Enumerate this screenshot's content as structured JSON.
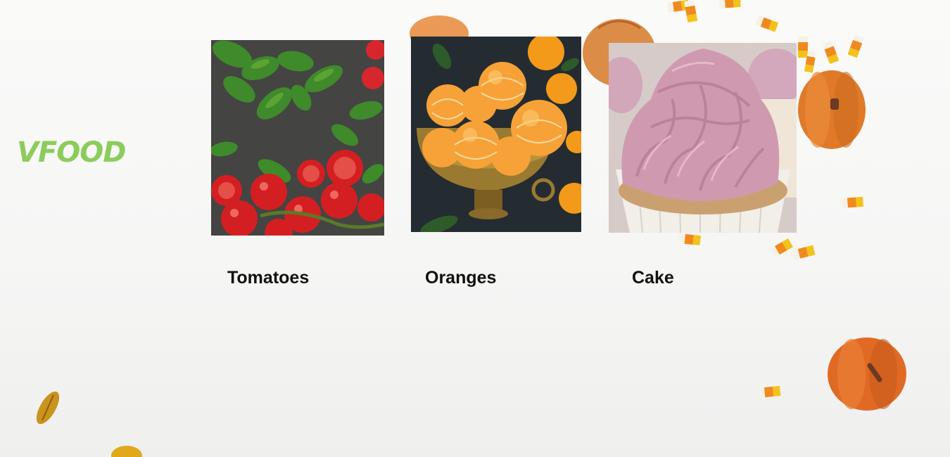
{
  "brand": {
    "logo_text": "VFOOD",
    "logo_color": "#8ccc5c"
  },
  "products": [
    {
      "name": "Tomatoes",
      "image": "tomatoes-with-basil"
    },
    {
      "name": "Oranges",
      "image": "peeled-oranges-in-brass-bowl"
    },
    {
      "name": "Cake",
      "image": "pink-frosted-cupcake"
    }
  ],
  "colors": {
    "background": "#f6f6f5",
    "label_text": "#111111"
  }
}
